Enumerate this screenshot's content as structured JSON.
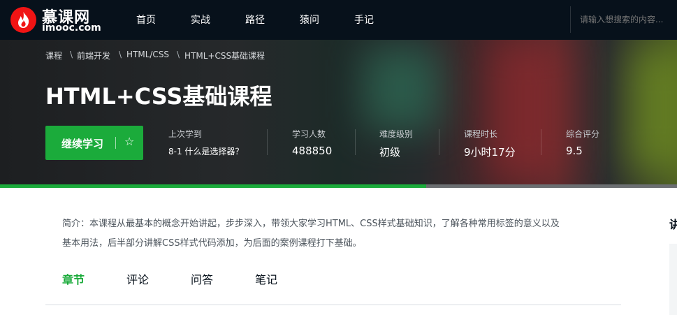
{
  "logo": {
    "name_cn": "慕课网",
    "name_en": "imooc.com"
  },
  "nav": {
    "items": [
      "首页",
      "实战",
      "路径",
      "猿问",
      "手记"
    ]
  },
  "search": {
    "placeholder": "请输入想搜索的内容..."
  },
  "breadcrumb": {
    "items": [
      "课程",
      "前端开发",
      "HTML/CSS",
      "HTML+CSS基础课程"
    ],
    "separator": "\\"
  },
  "course": {
    "title": "HTML+CSS基础课程",
    "continue_label": "继续学习",
    "favorite_icon": "star-outline-icon",
    "stats": {
      "last_learned_label": "上次学到",
      "last_learned_value": "8-1 什么是选择器？",
      "learners_label": "学习人数",
      "learners_value": "488850",
      "difficulty_label": "难度级别",
      "difficulty_value": "初级",
      "duration_label": "课程时长",
      "duration_value": "9小时17分",
      "rating_label": "综合评分",
      "rating_value": "9.5"
    },
    "progress_fraction": 0.63
  },
  "intro": {
    "line1": "简介：本课程从最基本的概念开始讲起，步步深入，带领大家学习HTML、CSS样式基础知识，了解各种常用标签的意义以及",
    "line2": "基本用法，后半部分讲解CSS样式代码添加，为后面的案例课程打下基础。"
  },
  "tabs": {
    "items": [
      "章节",
      "评论",
      "问答",
      "笔记"
    ],
    "active": "章节"
  },
  "sidebar": {
    "title_partial": "讲"
  },
  "colors": {
    "brand_green": "#1bab3b",
    "nav_bg": "#07111b",
    "logo_red": "#f01414"
  }
}
